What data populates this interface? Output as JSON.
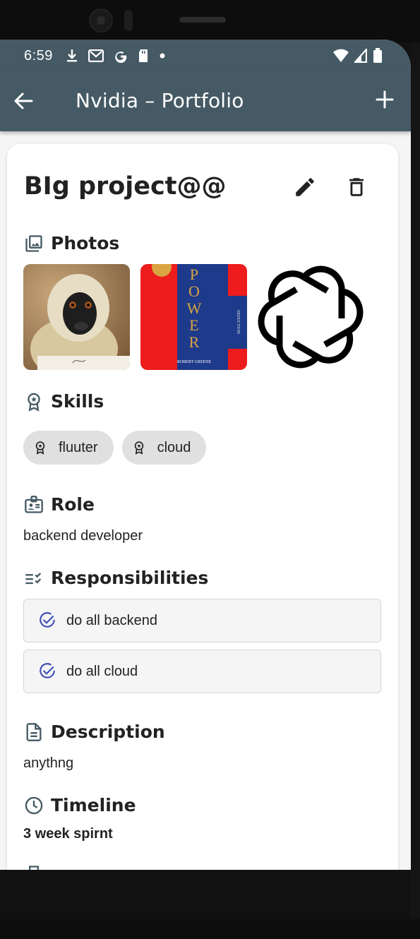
{
  "status_bar": {
    "time": "6:59",
    "icons": [
      "download-icon",
      "gmail-icon",
      "google-icon",
      "sd-card-icon",
      "dot-icon"
    ],
    "right_icons": [
      "wifi-icon",
      "signal-icon",
      "battery-icon"
    ]
  },
  "app_bar": {
    "title": "Nvidia – Portfolio",
    "back_icon": "arrow-back-icon",
    "add_icon": "plus-icon"
  },
  "project": {
    "title": "BIg project@@",
    "edit_icon": "pencil-icon",
    "delete_icon": "trash-icon"
  },
  "sections": {
    "photos": "Photos",
    "skills": "Skills",
    "role": "Role",
    "responsibilities": "Responsibilities",
    "description": "Description",
    "timeline": "Timeline"
  },
  "photos": [
    {
      "subject": "monkey-photo"
    },
    {
      "subject": "power-book-cover",
      "cover_text": "POWER",
      "spine_text": "SEDUCTION",
      "author": "ROBERT GREENE"
    },
    {
      "subject": "openai-logo"
    }
  ],
  "skills": [
    "fluuter",
    "cloud"
  ],
  "role": "backend developer",
  "responsibilities": [
    "do all backend",
    "do all cloud"
  ],
  "description": "anythng",
  "timeline": "3 week spirnt",
  "colors": {
    "app_bar": "#455a64",
    "accent": "#3f51b5",
    "chip_bg": "#e0e0e0"
  }
}
